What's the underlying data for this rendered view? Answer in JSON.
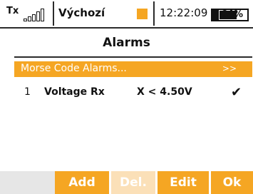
{
  "status_bar": {
    "tx_label": "Tx",
    "model_name": "Výchozí",
    "time": "12:22:09",
    "battery_percent": "64%",
    "battery_level": 0.64,
    "accent_color": "#f5a623"
  },
  "title": "Alarms",
  "menu": {
    "morse_label": "Morse Code Alarms...",
    "morse_arrow": ">>"
  },
  "alarms": [
    {
      "index": "1",
      "name": "Voltage Rx",
      "condition": "X < 4.50V",
      "enabled_mark": "✔"
    }
  ],
  "softkeys": {
    "add": "Add",
    "del": "Del.",
    "edit": "Edit",
    "ok": "Ok"
  }
}
